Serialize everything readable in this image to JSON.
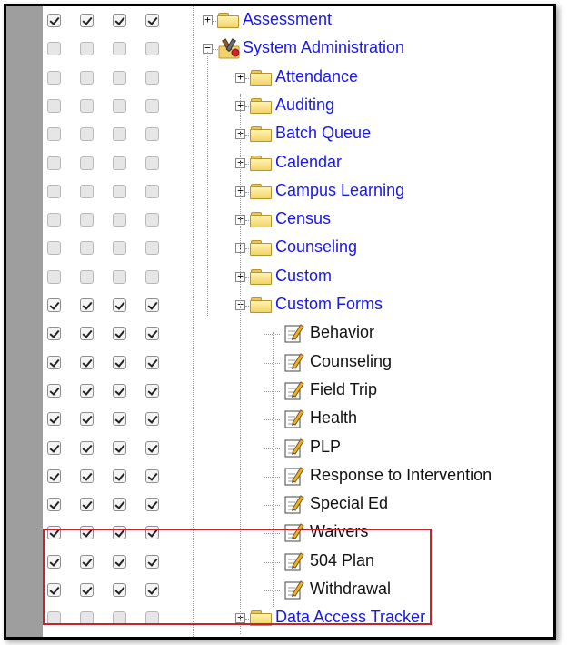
{
  "tree": {
    "rows": [
      {
        "label": "Assessment",
        "checks": [
          true,
          true,
          true,
          true
        ],
        "level": 0,
        "node": "folder",
        "expander": "+",
        "color": "link"
      },
      {
        "label": "System Administration",
        "checks": [
          false,
          false,
          false,
          false
        ],
        "level": 0,
        "node": "tools",
        "expander": "-",
        "color": "link"
      },
      {
        "label": "Attendance",
        "checks": [
          false,
          false,
          false,
          false
        ],
        "level": 1,
        "node": "folder",
        "expander": "+",
        "color": "link"
      },
      {
        "label": "Auditing",
        "checks": [
          false,
          false,
          false,
          false
        ],
        "level": 1,
        "node": "folder",
        "expander": "+",
        "color": "link"
      },
      {
        "label": "Batch Queue",
        "checks": [
          false,
          false,
          false,
          false
        ],
        "level": 1,
        "node": "folder",
        "expander": "+",
        "color": "link"
      },
      {
        "label": "Calendar",
        "checks": [
          false,
          false,
          false,
          false
        ],
        "level": 1,
        "node": "folder",
        "expander": "+",
        "color": "link"
      },
      {
        "label": "Campus Learning",
        "checks": [
          false,
          false,
          false,
          false
        ],
        "level": 1,
        "node": "folder",
        "expander": "+",
        "color": "link"
      },
      {
        "label": "Census",
        "checks": [
          false,
          false,
          false,
          false
        ],
        "level": 1,
        "node": "folder",
        "expander": "+",
        "color": "link"
      },
      {
        "label": "Counseling",
        "checks": [
          false,
          false,
          false,
          false
        ],
        "level": 1,
        "node": "folder",
        "expander": "+",
        "color": "link"
      },
      {
        "label": "Custom",
        "checks": [
          false,
          false,
          false,
          false
        ],
        "level": 1,
        "node": "folder",
        "expander": "+",
        "color": "link"
      },
      {
        "label": "Custom Forms",
        "checks": [
          true,
          true,
          true,
          true
        ],
        "level": 1,
        "node": "folder",
        "expander": "-",
        "color": "link"
      },
      {
        "label": "Behavior",
        "checks": [
          true,
          true,
          true,
          true
        ],
        "level": 2,
        "node": "doc",
        "expander": "",
        "color": "text"
      },
      {
        "label": "Counseling",
        "checks": [
          true,
          true,
          true,
          true
        ],
        "level": 2,
        "node": "doc",
        "expander": "",
        "color": "text"
      },
      {
        "label": "Field Trip",
        "checks": [
          true,
          true,
          true,
          true
        ],
        "level": 2,
        "node": "doc",
        "expander": "",
        "color": "text"
      },
      {
        "label": "Health",
        "checks": [
          true,
          true,
          true,
          true
        ],
        "level": 2,
        "node": "doc",
        "expander": "",
        "color": "text"
      },
      {
        "label": "PLP",
        "checks": [
          true,
          true,
          true,
          true
        ],
        "level": 2,
        "node": "doc",
        "expander": "",
        "color": "text"
      },
      {
        "label": "Response to Intervention",
        "checks": [
          true,
          true,
          true,
          true
        ],
        "level": 2,
        "node": "doc",
        "expander": "",
        "color": "text"
      },
      {
        "label": "Special Ed",
        "checks": [
          true,
          true,
          true,
          true
        ],
        "level": 2,
        "node": "doc",
        "expander": "",
        "color": "text"
      },
      {
        "label": "Waivers",
        "checks": [
          true,
          true,
          true,
          true
        ],
        "level": 2,
        "node": "doc",
        "expander": "",
        "color": "text"
      },
      {
        "label": "504 Plan",
        "checks": [
          true,
          true,
          true,
          true
        ],
        "level": 2,
        "node": "doc",
        "expander": "",
        "color": "text"
      },
      {
        "label": "Withdrawal",
        "checks": [
          true,
          true,
          true,
          true
        ],
        "level": 2,
        "node": "doc",
        "expander": "",
        "color": "text"
      },
      {
        "label": "Data Access Tracker",
        "checks": [
          false,
          false,
          false,
          false
        ],
        "level": 1,
        "node": "folder",
        "expander": "+",
        "color": "link"
      }
    ]
  },
  "colors": {
    "link": "#1818ee",
    "text": "#111111",
    "highlight": "#c8232c",
    "sidebar": "#9e9e9e"
  }
}
